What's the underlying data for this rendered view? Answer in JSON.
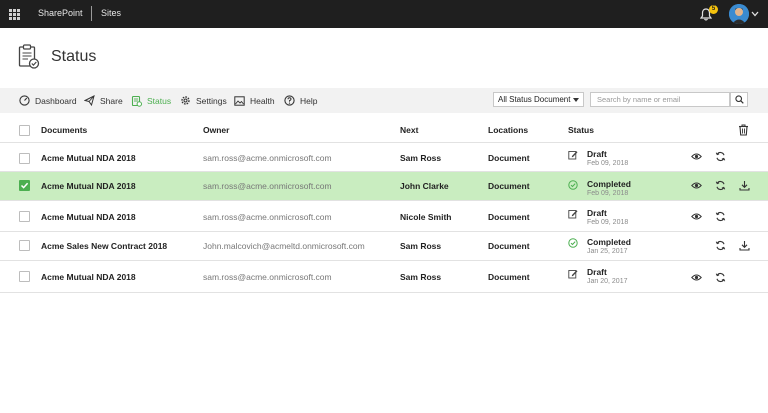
{
  "topbar": {
    "brand": "SharePoint",
    "section": "Sites",
    "notification_count": "5"
  },
  "page": {
    "title": "Status"
  },
  "toolbar": {
    "items": [
      {
        "label": "Dashboard",
        "icon": "gauge-icon"
      },
      {
        "label": "Share",
        "icon": "paper-plane-icon"
      },
      {
        "label": "Status",
        "icon": "document-status-icon",
        "active": true
      },
      {
        "label": "Settings",
        "icon": "gear-icon"
      },
      {
        "label": "Health",
        "icon": "image-icon"
      },
      {
        "label": "Help",
        "icon": "question-icon"
      }
    ],
    "filter_value": "All Status Document",
    "search_placeholder": "Search by name or email"
  },
  "table": {
    "headers": {
      "documents": "Documents",
      "owner": "Owner",
      "next": "Next",
      "locations": "Locations",
      "status": "Status"
    },
    "rows": [
      {
        "doc": "Acme Mutual NDA 2018",
        "owner": "sam.ross@acme.onmicrosoft.com",
        "next": "Sam Ross",
        "location": "Document",
        "status": "Draft",
        "date": "Feb 09, 2018",
        "checked": false,
        "download": false
      },
      {
        "doc": "Acme Mutual NDA 2018",
        "owner": "sam.ross@acme.onmicrosoft.com",
        "next": "John Clarke",
        "location": "Document",
        "status": "Completed",
        "date": "Feb 09, 2018",
        "checked": true,
        "download": true
      },
      {
        "doc": "Acme Mutual NDA 2018",
        "owner": "sam.ross@acme.onmicrosoft.com",
        "next": "Nicole Smith",
        "location": "Document",
        "status": "Draft",
        "date": "Feb 09, 2018",
        "checked": false,
        "download": false
      },
      {
        "doc": "Acme Sales New Contract 2018",
        "owner": "John.malcovich@acmeltd.onmicrosoft.com",
        "next": "Sam Ross",
        "location": "Document",
        "status": "Completed",
        "date": "Jan 25, 2017",
        "checked": false,
        "download": true
      },
      {
        "doc": "Acme Mutual NDA 2018",
        "owner": "sam.ross@acme.onmicrosoft.com",
        "next": "Sam Ross",
        "location": "Document",
        "status": "Draft",
        "date": "Jan 20, 2017",
        "checked": false,
        "download": false
      }
    ]
  },
  "colors": {
    "accent": "#4caf50",
    "selected_row": "#c9edc0",
    "topbar": "#1f1f1f"
  }
}
